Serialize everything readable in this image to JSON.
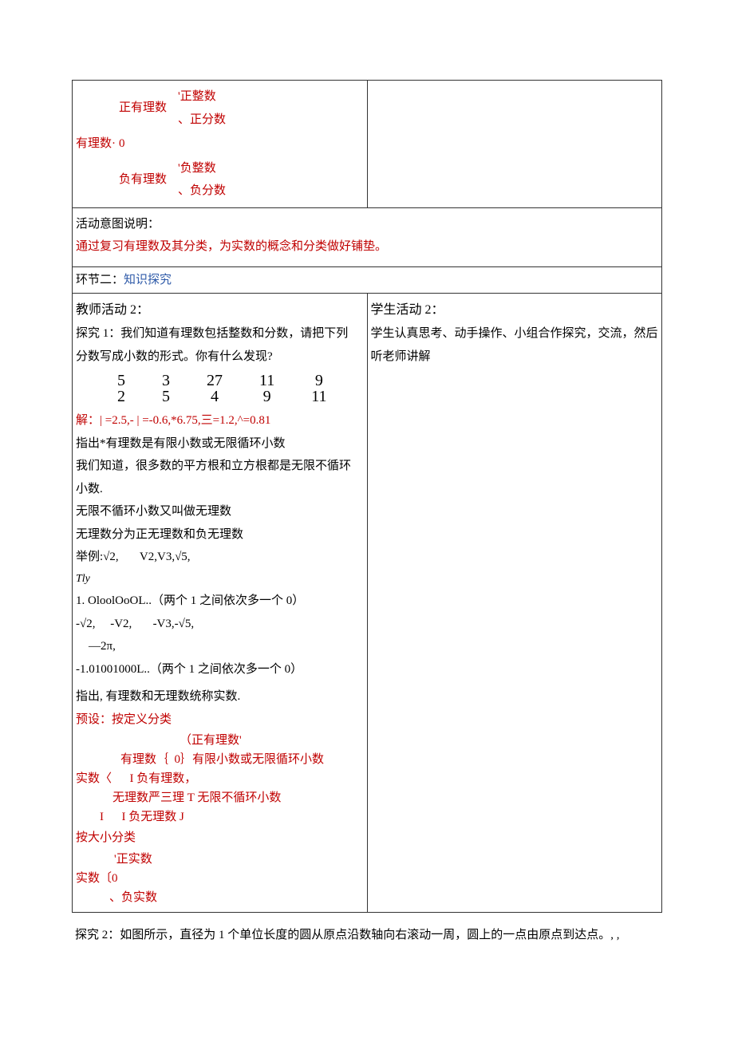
{
  "row1": {
    "left": {
      "label": "有理数·",
      "pos_rational": "正有理数",
      "pos_int": "'正整数",
      "pos_frac": "、正分数",
      "zero": "0",
      "neg_rational": "负有理数",
      "neg_int": "'负整数",
      "neg_frac": "、负分数"
    }
  },
  "activity_label": "活动意图说明：",
  "activity_desc": "通过复习有理数及其分类，为实数的概念和分类做好铺垫。",
  "section2_prefix": "环节二：",
  "section2_title": "知识探究",
  "teacher_title": "教师活动 2：",
  "student_title": "学生活动 2：",
  "explore1_intro_l1": "探究 1：我们知道有理数包括整数和分数，请把下列",
  "explore1_intro_l2": "分数写成小数的形式。你有什么发现?",
  "fractions": [
    {
      "num": "5",
      "den": "2"
    },
    {
      "num": "3",
      "den": "5"
    },
    {
      "num": "27",
      "den": "4"
    },
    {
      "num": "11",
      "den": "9"
    },
    {
      "num": "9",
      "den": "11"
    }
  ],
  "solution_line": "| =2.5,- | =-0.6,*6.75,三=1.2,^=0.81",
  "solution_prefix": "解：",
  "t_l1": "指出*有理数是有限小数或无限循环小数",
  "t_l2": "我们知道，很多数的平方根和立方根都是无限不循环",
  "t_l3": "小数.",
  "t_l4": "无限不循环小数又叫做无理数",
  "t_l5": "无理数分为正无理数和负无理数",
  "t_l6_a": "举例:",
  "t_l6_b": "√2,",
  "t_l6_c": "V2,V3,√5,",
  "t_ital": "Tly",
  "t_l7_a": "1.",
  "t_l7_b": "OloolOoOL..（两个 1 之间依次多一个 0）",
  "t_neg_a": "-√2,",
  "t_neg_b": "-V2,",
  "t_neg_c": "-V3,-√5,",
  "t_neg2": "—2π,",
  "t_l8": "-1.01001000L..（两个 1 之间依次多一个 0）",
  "t_l9": "指出, 有理数和无理数统称实数.",
  "preset_label": "预设：按定义分类",
  "tree_def": {
    "l0": "（正有理数'",
    "l1_a": "有理数｛",
    "l1_b": "0｝有限小数或无限循环小数",
    "l2_a": "实数〈",
    "l2_b": "I 负有理数，",
    "l3": "无理数严三理 T 无限不循环小数",
    "l4_a": "I",
    "l4_b": "I 负无理数 J"
  },
  "size_label": "按大小分类",
  "tree_size": {
    "l0": "'正实数",
    "l1": "实数〔0",
    "l2": "、负实数"
  },
  "student_body": "学生认真思考、动手操作、小组合作探究，交流，然后听老师讲解",
  "post": "探究 2：如图所示，直径为 1 个单位长度的圆从原点沿数轴向右滚动一周，圆上的一点由原点到达点。, ,"
}
